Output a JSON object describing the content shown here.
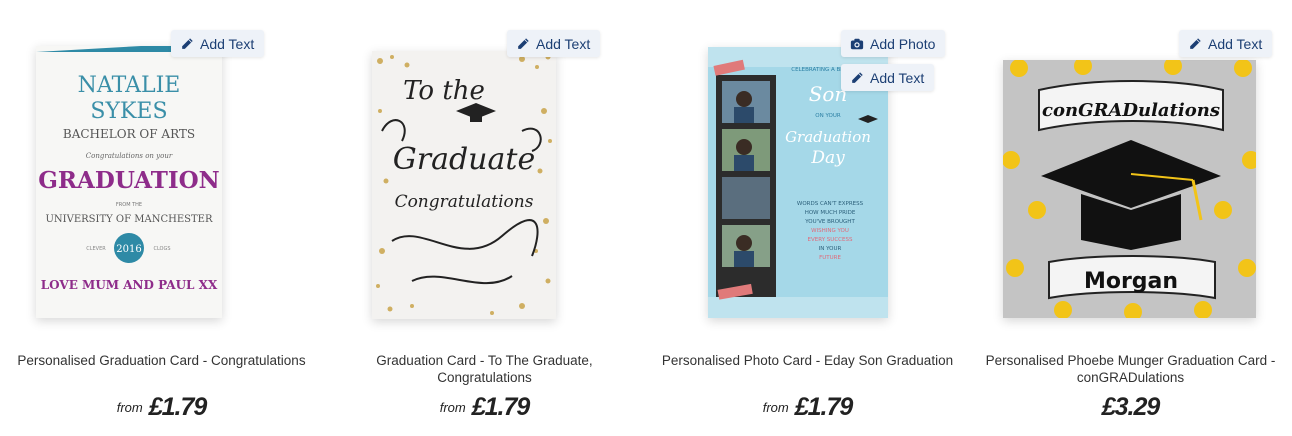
{
  "colors": {
    "badge_bg": "#eef2f8",
    "badge_text": "#1c3f74"
  },
  "products": [
    {
      "title": "Personalised Graduation Card - Congratulations",
      "price_prefix": "from",
      "price": "£1.79",
      "actions": [
        {
          "label": "Add Text",
          "icon": "pencil-icon"
        }
      ],
      "card_text": {
        "line1": "NATALIE",
        "line2": "SYKES",
        "line3": "BACHELOR OF ARTS",
        "line4": "Congratulations on your",
        "line5": "GRADUATION",
        "line6": "FROM THE",
        "line7": "UNIVERSITY OF MANCHESTER",
        "left_word": "CLEVER",
        "year": "2016",
        "right_word": "CLOGS",
        "footer": "LOVE MUM AND PAUL XX"
      }
    },
    {
      "title": "Graduation Card - To The Graduate, Congratulations",
      "price_prefix": "from",
      "price": "£1.79",
      "actions": [
        {
          "label": "Add Text",
          "icon": "pencil-icon"
        }
      ],
      "card_text": {
        "line1": "To the",
        "line2": "Graduate",
        "line3": "Congratulations"
      }
    },
    {
      "title": "Personalised Photo Card - Eday Son Graduation",
      "price_prefix": "from",
      "price": "£1.79",
      "actions": [
        {
          "label": "Add Photo",
          "icon": "camera-icon"
        },
        {
          "label": "Add Text",
          "icon": "pencil-icon"
        }
      ],
      "card_text": {
        "line1": "CELEBRATING A BRILLIANT",
        "line2": "Son",
        "line3": "ON YOUR",
        "line4": "Graduation",
        "line5": "Day",
        "msg1": "WORDS CAN'T EXPRESS",
        "msg2": "HOW MUCH PRIDE",
        "msg3": "YOU'VE BROUGHT",
        "msg4": "WISHING YOU",
        "msg5": "EVERY SUCCESS",
        "msg6": "IN YOUR",
        "msg7": "FUTURE"
      }
    },
    {
      "title": "Personalised Phoebe Munger Graduation Card - conGRADulations",
      "price_prefix": "",
      "price": "£3.29",
      "actions": [
        {
          "label": "Add Text",
          "icon": "pencil-icon"
        }
      ],
      "card_text": {
        "banner": "conGRADulations",
        "name": "Morgan"
      }
    }
  ]
}
